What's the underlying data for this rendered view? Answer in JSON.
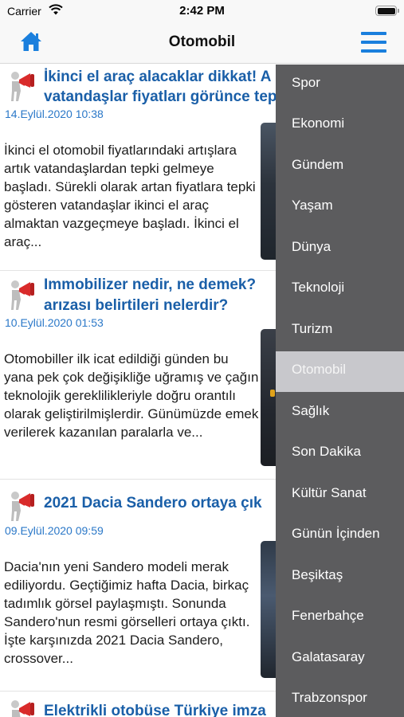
{
  "status_bar": {
    "carrier": "Carrier",
    "time": "2:42 PM"
  },
  "nav": {
    "title": "Otomobil",
    "home_icon": "home-icon",
    "menu_icon": "hamburger-menu-icon"
  },
  "articles": [
    {
      "title_line1": "İkinci el araç alacaklar dikkat! A",
      "title_line2": "vatandaşlar fiyatları görünce tep",
      "date": "14.Eylül.2020 10:38",
      "text": "İkinci el otomobil fiyatlarındaki artışlara artık vatandaşlardan tepki gelmeye başladı. Sürekli olarak artan fiyatlara tepki gösteren vatandaşlar ikinci el araç almaktan vazgeçmeye başladı. İkinci el araç..."
    },
    {
      "title_line1": "Immobilizer nedir, ne demek?",
      "title_line2": "arızası belirtileri nelerdir?",
      "date": "10.Eylül.2020 01:53",
      "text": "Otomobiller ilk icat edildiği günden bu yana pek çok değişikliğe uğramış ve çağın teknolojik gereklilikleriyle doğru orantılı olarak geliştirilmişlerdir. Günümüzde emek verilerek kazanılan paralarla ve..."
    },
    {
      "title_line1": "2021 Dacia Sandero ortaya çık",
      "title_line2": "",
      "date": "09.Eylül.2020 09:59",
      "text": "Dacia'nın yeni Sandero modeli merak ediliyordu. Geçtiğimiz hafta Dacia, birkaç tadımlık görsel paylaşmıştı. Sonunda Sandero'nun resmi görselleri ortaya çıktı. İşte karşınızda 2021 Dacia Sandero, crossover..."
    },
    {
      "title_line1": "Elektrikli otobüse Türkiye imza",
      "title_line2": "",
      "date": "",
      "text": ""
    }
  ],
  "menu": {
    "active": "Otomobil",
    "items": [
      "Spor",
      "Ekonomi",
      "Gündem",
      "Yaşam",
      "Dünya",
      "Teknoloji",
      "Turizm",
      "Otomobil",
      "Sağlık",
      "Son Dakika",
      "Kültür Sanat",
      "Günün İçinden",
      "Beşiktaş",
      "Fenerbahçe",
      "Galatasaray",
      "Trabzonspor"
    ]
  },
  "colors": {
    "accent": "#1a7fdd",
    "title_blue": "#1a5fa8",
    "date_blue": "#2b78c8",
    "menu_bg": "#5c5c5e",
    "menu_active_bg": "#c8c8cc"
  }
}
